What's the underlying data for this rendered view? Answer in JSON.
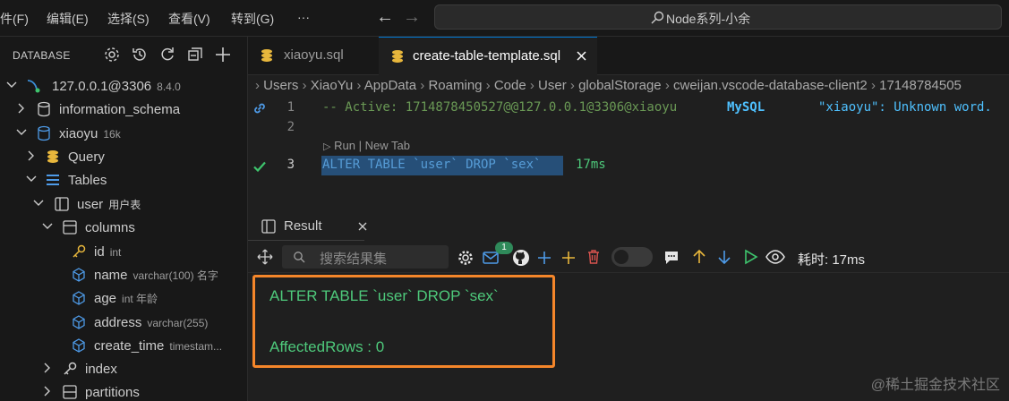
{
  "menu": {
    "items": [
      "件(F)",
      "编辑(E)",
      "选择(S)",
      "查看(V)",
      "转到(G)",
      "···"
    ],
    "command_center": "Node系列-小余"
  },
  "sidebar": {
    "title": "DATABASE",
    "tree": {
      "connection": {
        "label": "127.0.0.1@3306",
        "version": "8.4.0"
      },
      "information_schema": "information_schema",
      "database": {
        "label": "xiaoyu",
        "size": "16k"
      },
      "query": "Query",
      "tables": "Tables",
      "table": {
        "label": "user",
        "comment": "用户表"
      },
      "columns": "columns",
      "cols": [
        {
          "name": "id",
          "type": "int"
        },
        {
          "name": "name",
          "type": "varchar(100) 名字"
        },
        {
          "name": "age",
          "type": "int 年龄"
        },
        {
          "name": "address",
          "type": "varchar(255)"
        },
        {
          "name": "create_time",
          "type": "timestam..."
        }
      ],
      "index": "index",
      "partitions": "partitions"
    }
  },
  "tabs": [
    {
      "label": "xiaoyu.sql",
      "active": false
    },
    {
      "label": "create-table-template.sql",
      "active": true
    }
  ],
  "breadcrumb": [
    "Users",
    "XiaoYu",
    "AppData",
    "Roaming",
    "Code",
    "User",
    "globalStorage",
    "cweijan.vscode-database-client2",
    "17148784505"
  ],
  "editor": {
    "lines": [
      {
        "num": "1",
        "text": "-- Active: 1714878450527@@127.0.0.1@3306@xiaoyu",
        "lang": "MySQL",
        "extra": "\"xiaoyu\": Unknown word."
      },
      {
        "num": "2",
        "text": ""
      },
      {
        "num": "3",
        "text": "ALTER TABLE `user` DROP `sex`",
        "timing": "17ms"
      }
    ],
    "codelens": {
      "run": "Run",
      "sep": "|",
      "new_tab": "New Tab"
    }
  },
  "result": {
    "title": "Result",
    "search_placeholder": "搜索结果集",
    "badge": "1",
    "elapsed": "耗时: 17ms",
    "sql": "ALTER TABLE `user` DROP `sex`",
    "affected": "AffectedRows : 0"
  },
  "watermark": "@稀土掘金技术社区",
  "colors": {
    "accent": "#0078d4",
    "highlight_box": "#f5862a",
    "result_text": "#4ec97b"
  }
}
